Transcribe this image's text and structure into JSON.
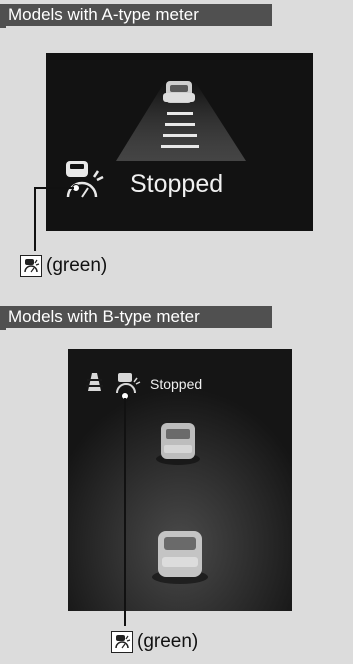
{
  "section_a": {
    "title": "Models with A-type meter",
    "status_text": "Stopped",
    "callout": "(green)",
    "icon": "traffic-jam-assist-icon"
  },
  "section_b": {
    "title": "Models with B-type meter",
    "status_text": "Stopped",
    "callout": "(green)",
    "icon": "traffic-jam-assist-icon"
  },
  "colors": {
    "section_header_bg": "#505050",
    "page_bg": "#dcdcdc",
    "screen_bg": "#111111"
  }
}
